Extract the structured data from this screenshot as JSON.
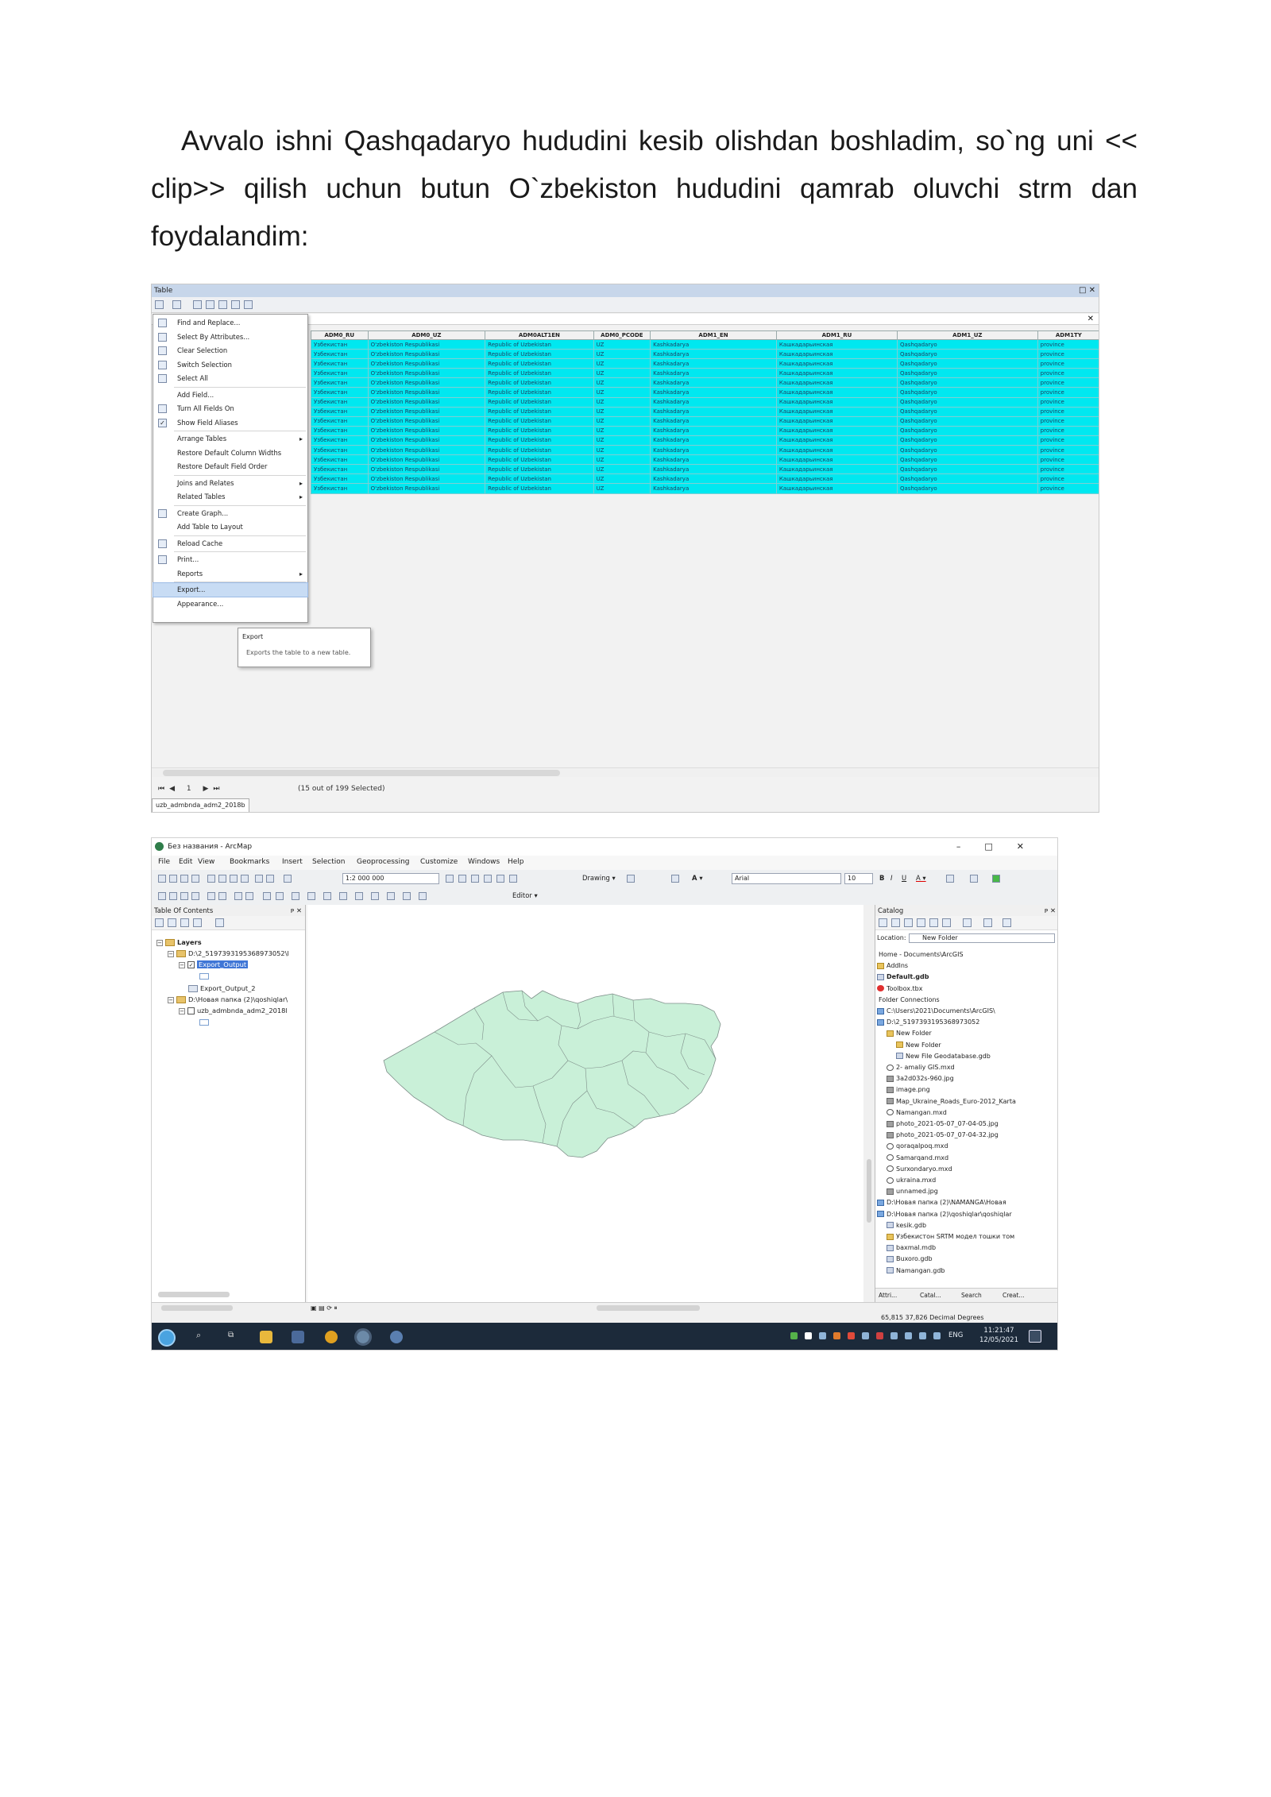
{
  "paragraph": "Avvalo ishni Qashqadaryo  hududini kesib olishdan boshladim, so`ng uni << clip>> qilish uchun butun O`zbekiston hududini qamrab oluvchi strm dan foydalandim:",
  "table_window": {
    "title": "Table",
    "columns": [
      "ADM0_RU",
      "ADM0_UZ",
      "ADM0ALT1EN",
      "ADM0_PCODE",
      "ADM1_EN",
      "ADM1_RU",
      "ADM1_UZ",
      "ADM1TY"
    ],
    "row_values": [
      "Узбекистан",
      "O'zbekiston Respublikasi",
      "Republic of Uzbekistan",
      "UZ",
      "Kashkadarya",
      "Кашкадарьинская",
      "Qashqadaryo",
      "province"
    ],
    "row_count": 16,
    "context_menu": [
      {
        "label": "Find and Replace...",
        "icon": "binoculars-icon"
      },
      {
        "label": "Select By Attributes...",
        "icon": "select-attributes-icon"
      },
      {
        "label": "Clear Selection",
        "icon": "clear-selection-icon"
      },
      {
        "label": "Switch Selection",
        "icon": "switch-selection-icon"
      },
      {
        "label": "Select All",
        "icon": "select-all-icon"
      },
      {
        "label": "Add Field...",
        "icon": ""
      },
      {
        "label": "Turn All Fields On",
        "icon": "fields-icon"
      },
      {
        "label": "Show Field Aliases",
        "icon": "checkmark-icon"
      },
      {
        "label": "Arrange Tables",
        "icon": "",
        "submenu": true
      },
      {
        "label": "Restore Default Column Widths",
        "icon": ""
      },
      {
        "label": "Restore Default Field Order",
        "icon": ""
      },
      {
        "label": "Joins and Relates",
        "icon": "",
        "submenu": true
      },
      {
        "label": "Related Tables",
        "icon": "",
        "submenu": true
      },
      {
        "label": "Create Graph...",
        "icon": "graph-icon"
      },
      {
        "label": "Add Table to Layout",
        "icon": ""
      },
      {
        "label": "Reload Cache",
        "icon": "reload-icon"
      },
      {
        "label": "Print...",
        "icon": "print-icon"
      },
      {
        "label": "Reports",
        "icon": "",
        "submenu": true
      },
      {
        "label": "Export...",
        "icon": "",
        "highlighted": true
      },
      {
        "label": "Appearance...",
        "icon": ""
      }
    ],
    "tooltip": {
      "title": "Export",
      "body": "Exports the table to a new table."
    },
    "record_nav": "1",
    "selection_status": "(15 out of 199 Selected)",
    "tab_label": "uzb_admbnda_adm2_2018b"
  },
  "arcmap": {
    "title": "Без названия - ArcMap",
    "menu": [
      "File",
      "Edit",
      "View",
      "Bookmarks",
      "Insert",
      "Selection",
      "Geoprocessing",
      "Customize",
      "Windows",
      "Help"
    ],
    "scale": "1:2 000 000",
    "drawing_label": "Drawing",
    "font_name": "Arial",
    "font_size": "10",
    "editor_label": "Editor",
    "toc_title": "Table Of Contents",
    "toc": [
      {
        "label": "Layers",
        "type": "root"
      },
      {
        "label": "D:\\2_5197393195368973052\\l",
        "type": "folder"
      },
      {
        "label": "Export_Output",
        "type": "layer",
        "highlighted": true
      },
      {
        "label": "Export_Output_2",
        "type": "table"
      },
      {
        "label": "D:\\Новая папка (2)\\qoshiqlar\\",
        "type": "folder"
      },
      {
        "label": "uzb_admbnda_adm2_2018l",
        "type": "layer"
      }
    ],
    "map_fill_color": "#c9f0d8",
    "map_stroke_color": "#7f8f8a",
    "catalog_title": "Catalog",
    "location_label": "Location:",
    "location_value": "New Folder",
    "catalog": [
      {
        "label": "Home - Documents\\ArcGIS",
        "icon": "",
        "indent": 0
      },
      {
        "label": "AddIns",
        "icon": "folder",
        "indent": 0
      },
      {
        "label": "Default.gdb",
        "icon": "gdb",
        "indent": 0
      },
      {
        "label": "Toolbox.tbx",
        "icon": "red",
        "indent": 0
      },
      {
        "label": "Folder Connections",
        "icon": "",
        "indent": 0
      },
      {
        "label": "C:\\Users\\2021\\Documents\\ArcGIS\\",
        "icon": "conn",
        "indent": 0
      },
      {
        "label": "D:\\2_5197393195368973052",
        "icon": "conn",
        "indent": 0
      },
      {
        "label": "New Folder",
        "icon": "folder",
        "indent": 1
      },
      {
        "label": "New Folder",
        "icon": "folder",
        "indent": 2
      },
      {
        "label": "New File Geodatabase.gdb",
        "icon": "gdb",
        "indent": 2
      },
      {
        "label": "2- amaliy GIS.mxd",
        "icon": "mxd",
        "indent": 1
      },
      {
        "label": "3a2d032s-960.jpg",
        "icon": "img",
        "indent": 1
      },
      {
        "label": "image.png",
        "icon": "img",
        "indent": 1
      },
      {
        "label": "Map_Ukraine_Roads_Euro-2012_Karta",
        "icon": "img",
        "indent": 1
      },
      {
        "label": "Namangan.mxd",
        "icon": "mxd",
        "indent": 1
      },
      {
        "label": "photo_2021-05-07_07-04-05.jpg",
        "icon": "img",
        "indent": 1
      },
      {
        "label": "photo_2021-05-07_07-04-32.jpg",
        "icon": "img",
        "indent": 1
      },
      {
        "label": "qoraqalpoq.mxd",
        "icon": "mxd",
        "indent": 1
      },
      {
        "label": "Samarqand.mxd",
        "icon": "mxd",
        "indent": 1
      },
      {
        "label": "Surxondaryo.mxd",
        "icon": "mxd",
        "indent": 1
      },
      {
        "label": "ukraina.mxd",
        "icon": "mxd",
        "indent": 1
      },
      {
        "label": "unnamed.jpg",
        "icon": "img",
        "indent": 1
      },
      {
        "label": "D:\\Новая папка (2)\\NAMANGA\\Новая",
        "icon": "conn",
        "indent": 0
      },
      {
        "label": "D:\\Новая папка (2)\\qoshiqlar\\qoshiqlar",
        "icon": "conn",
        "indent": 0
      },
      {
        "label": "kesik.gdb",
        "icon": "gdb",
        "indent": 1
      },
      {
        "label": "Узбекистон SRTM модел тошки том",
        "icon": "folder",
        "indent": 1
      },
      {
        "label": "baxmal.mdb",
        "icon": "gdb",
        "indent": 1
      },
      {
        "label": "Buxoro.gdb",
        "icon": "gdb",
        "indent": 1
      },
      {
        "label": "Namangan.gdb",
        "icon": "gdb",
        "indent": 1
      }
    ],
    "catalog_tabs": [
      "Attri...",
      "Catal...",
      "Search",
      "Creat..."
    ],
    "coordinates": "65,815  37,826 Decimal Degrees",
    "taskbar_lang": "ENG",
    "taskbar_time": "11:21:47",
    "taskbar_date": "12/05/2021"
  }
}
